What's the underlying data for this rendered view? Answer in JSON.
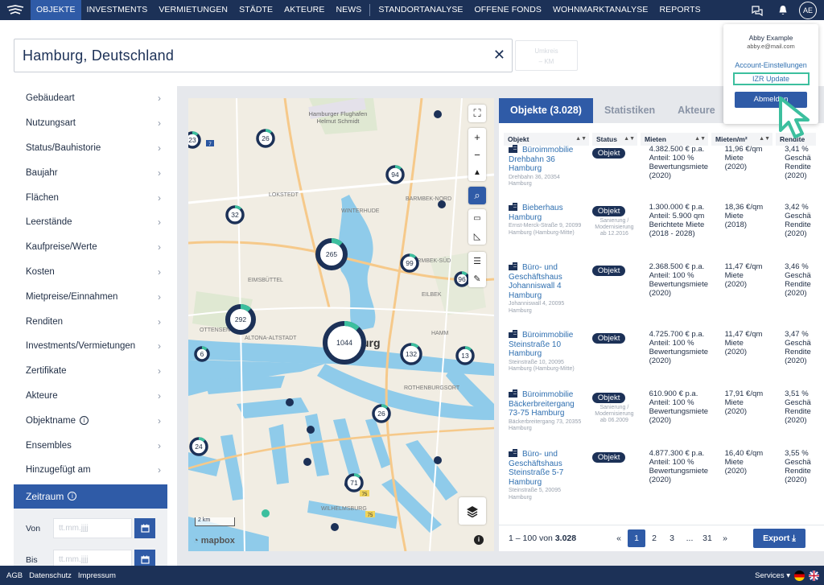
{
  "nav": {
    "items": [
      "OBJEKTE",
      "INVESTMENTS",
      "VERMIETUNGEN",
      "STÄDTE",
      "AKTEURE",
      "NEWS"
    ],
    "items2": [
      "STANDORTANALYSE",
      "OFFENE FONDS",
      "WOHNMARKTANALYSE",
      "REPORTS"
    ],
    "avatar": "AE"
  },
  "search": {
    "value": "Hamburg, Deutschland",
    "clear": "✕",
    "radius_label": "Umkreis",
    "radius_value": "– KM"
  },
  "sidebar": {
    "items": [
      "Gebäudeart",
      "Nutzungsart",
      "Status/Bauhistorie",
      "Baujahr",
      "Flächen",
      "Leerstände",
      "Kaufpreise/Werte",
      "Kosten",
      "Mietpreise/Einnahmen",
      "Renditen",
      "Investments/Vermietungen",
      "Zertifikate",
      "Akteure",
      "Objektname",
      "Ensembles",
      "Hinzugefügt am"
    ],
    "active": "Zeitraum",
    "from_label": "Von",
    "to_label": "Bis",
    "date_placeholder": "tt.mm.jjjj"
  },
  "map": {
    "clusters": [
      {
        "label": "23"
      },
      {
        "label": "26"
      },
      {
        "label": "94"
      },
      {
        "label": "32"
      },
      {
        "label": "265"
      },
      {
        "label": "99"
      },
      {
        "label": "96"
      },
      {
        "label": "292"
      },
      {
        "label": "1044"
      },
      {
        "label": "132"
      },
      {
        "label": "13"
      },
      {
        "label": "6"
      },
      {
        "label": "26"
      },
      {
        "label": "24"
      },
      {
        "label": "71"
      }
    ],
    "place_labels": [
      "Hamburger Flughafen",
      "Helmut Schmidt",
      "LOKSTEDT",
      "WINTERHUDE",
      "BARMBEK-NORD",
      "BARMBEK-SÜD",
      "EIMSBÜTTEL",
      "EILBEK",
      "OTTENSEN",
      "ALTONA-ALTSTADT",
      "HAMM",
      "ROTHENBURGSORT",
      "WILHELMSBURG",
      "urg"
    ],
    "scale": "2 km",
    "brand": "mapbox"
  },
  "results": {
    "tabs": [
      "Objekte (3.028)",
      "Statistiken",
      "Akteure"
    ],
    "columns": [
      "Objekt",
      "Status",
      "Mieten",
      "Mieten/m²",
      "Rendite"
    ],
    "rows": [
      {
        "title": "Büroimmobilie Drehbahn 36 Hamburg",
        "addr": "Drehbahn 36, 20354 Hamburg",
        "status": "Objekt",
        "status_note": "",
        "miete": "4.382.500 € p.a.\nAnteil: 100 %\nBewertungsmiete\n(2020)",
        "miete_qm": "11,96 €/qm\nMiete\n(2020)",
        "rendite": "3,41 %\nGeschä\nRendite\n(2020)"
      },
      {
        "title": "Bieberhaus Hamburg",
        "addr": "Ernst-Merck-Straße 9, 20099 Hamburg (Hamburg-Mitte)",
        "status": "Objekt",
        "status_note": "Sanierung / Modernisierung ab 12.2016",
        "miete": "1.300.000 € p.a.\nAnteil: 5.900 qm\nBerichtete Miete\n(2018 - 2028)",
        "miete_qm": "18,36 €/qm\nMiete\n(2018)",
        "rendite": "3,42 %\nGeschä\nRendite\n(2020)"
      },
      {
        "title": "Büro- und Geschäftshaus Johanniswall 4 Hamburg",
        "addr": "Johanniswall 4, 20095 Hamburg",
        "status": "Objekt",
        "status_note": "",
        "miete": "2.368.500 € p.a.\nAnteil: 100 %\nBewertungsmiete\n(2020)",
        "miete_qm": "11,47 €/qm\nMiete\n(2020)",
        "rendite": "3,46 %\nGeschä\nRendite\n(2020)"
      },
      {
        "title": "Büroimmobilie Steinstraße 10 Hamburg",
        "addr": "Steinstraße 10, 20095 Hamburg (Hamburg-Mitte)",
        "status": "Objekt",
        "status_note": "",
        "miete": "4.725.700 € p.a.\nAnteil: 100 %\nBewertungsmiete\n(2020)",
        "miete_qm": "11,47 €/qm\nMiete\n(2020)",
        "rendite": "3,47 %\nGeschä\nRendite\n(2020)"
      },
      {
        "title": "Büroimmobilie Bäckerbreitergang 73-75 Hamburg",
        "addr": "Bäckerbreitergang 73, 20355 Hamburg",
        "status": "Objekt",
        "status_note": "Sanierung / Modernisierung ab 06.2009",
        "miete": "610.900 € p.a.\nAnteil: 100 %\nBewertungsmiete\n(2020)",
        "miete_qm": "17,91 €/qm\nMiete\n(2020)",
        "rendite": "3,51 %\nGeschä\nRendite\n(2020)"
      },
      {
        "title": "Büro- und Geschäftshaus Steinstraße 5-7 Hamburg",
        "addr": "Steinstraße 5, 20095 Hamburg",
        "status": "Objekt",
        "status_note": "",
        "miete": "4.877.300 € p.a.\nAnteil: 100 %\nBewertungsmiete\n(2020)",
        "miete_qm": "16,40 €/qm\nMiete\n(2020)",
        "rendite": "3,55 %\nGeschä\nRendite\n(2020)"
      }
    ],
    "count_text": "1 – 100 von",
    "count_total": "3.028",
    "pages": [
      "«",
      "1",
      "2",
      "3",
      "...",
      "31",
      "»"
    ],
    "export": "Export"
  },
  "account": {
    "name": "Abby Example",
    "email": "abby.e@mail.com",
    "settings": "Account-Einstellungen",
    "update": "IZR Update",
    "logout": "Abmelden"
  },
  "footer": {
    "links": [
      "AGB",
      "Datenschutz",
      "Impressum"
    ],
    "services": "Services ▾"
  },
  "colors": {
    "navy": "#1c3157",
    "accent": "#2f5ba7",
    "highlight": "#3cbf9e",
    "water": "#8fcbea"
  }
}
